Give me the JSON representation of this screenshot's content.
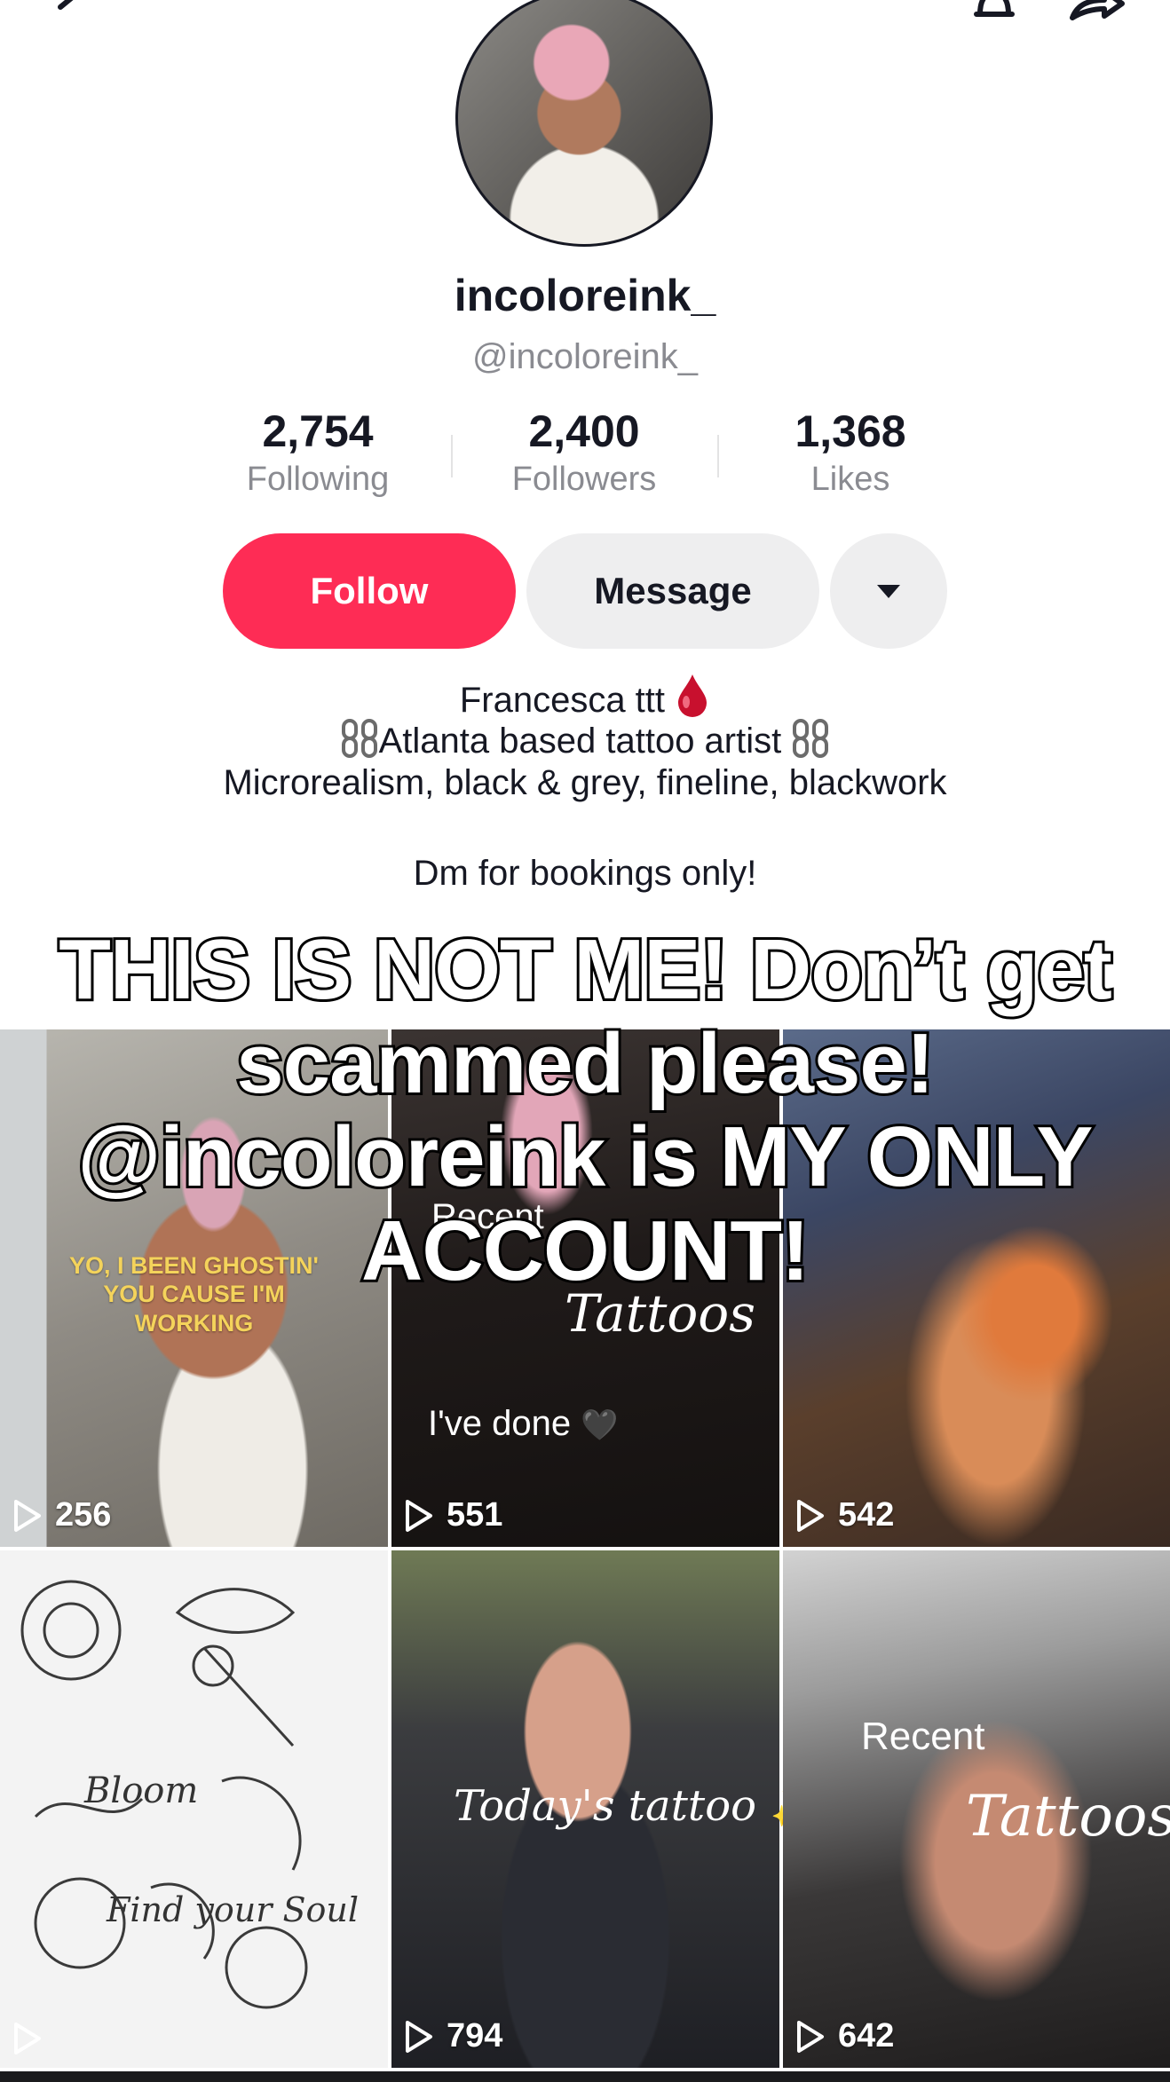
{
  "profile": {
    "display_name": "incoloreink_",
    "handle": "@incoloreink_",
    "stats": [
      {
        "value": "2,754",
        "label": "Following"
      },
      {
        "value": "2,400",
        "label": "Followers"
      },
      {
        "value": "1,368",
        "label": "Likes"
      }
    ],
    "buttons": {
      "follow": "Follow",
      "message": "Message"
    },
    "bio": {
      "line1": "Francesca ttt",
      "line2": "Atlanta based tattoo artist",
      "line3": "Microrealism, black & grey, fineline, blackwork",
      "line4": "Dm for bookings only!"
    }
  },
  "caption": {
    "line1": "THIS IS NOT ME! Don’t get",
    "line2": "scammed please!",
    "line3": "@incoloreink is MY ONLY",
    "line4": "ACCOUNT!"
  },
  "videos": [
    {
      "views": "256",
      "overlay": "YO, I BEEN GHOSTIN' YOU CAUSE I'M WORKING"
    },
    {
      "views": "551",
      "overlay_recent": "Recent",
      "overlay_tattoos": "Tattoos",
      "overlay_done": "I've done"
    },
    {
      "views": "542"
    },
    {
      "views": "",
      "overlay_bloom": "Bloom",
      "overlay_find": "Find your Soul"
    },
    {
      "views": "794",
      "overlay_today": "Today's tattoo"
    },
    {
      "views": "642",
      "overlay_recent": "Recent",
      "overlay_tattoos": "Tattoos"
    }
  ],
  "colors": {
    "follow": "#fe2c55",
    "secondary_btn": "#eeeeef",
    "muted_text": "#8a8b91"
  }
}
